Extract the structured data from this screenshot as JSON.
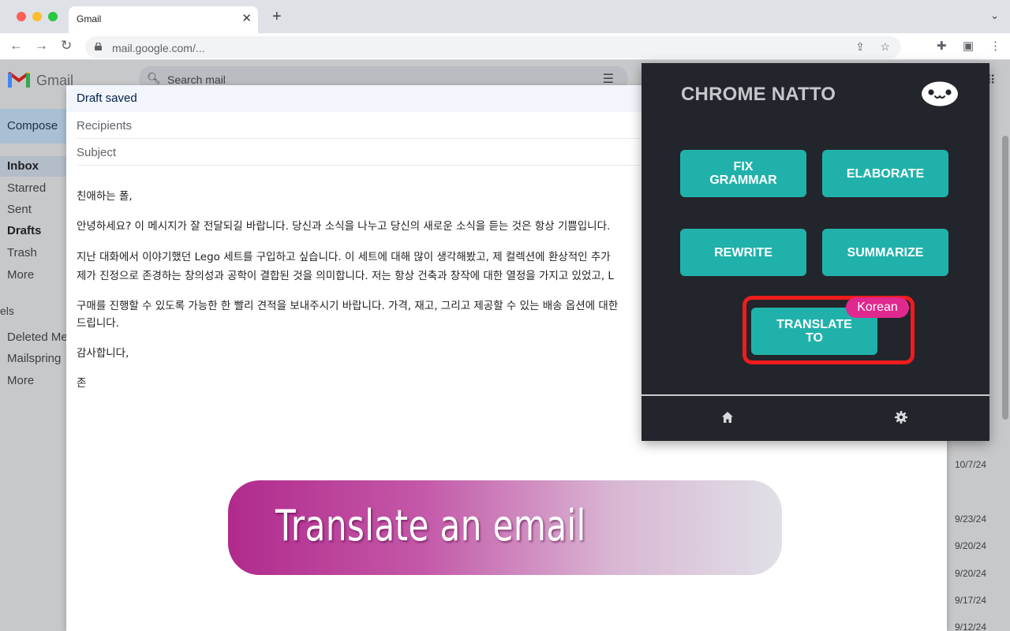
{
  "browser": {
    "tab_title": "Gmail",
    "url": "mail.google.com/..."
  },
  "gmail": {
    "brand": "Gmail",
    "search_placeholder": "Search mail",
    "compose_label": "Compose",
    "nav": [
      "Inbox",
      "Starred",
      "Sent",
      "Drafts",
      "Trash",
      "More"
    ],
    "labels_heading": "els",
    "labels": [
      "Deleted Me",
      "Mailspring",
      "More"
    ],
    "dates": [
      "10/7/24",
      "9/23/24",
      "9/20/24",
      "9/20/24",
      "9/17/24",
      "9/12/24"
    ]
  },
  "compose": {
    "status": "Draft saved",
    "recipients_placeholder": "Recipients",
    "subject_placeholder": "Subject",
    "body_lines": [
      "친애하는 폴,",
      "안녕하세요? 이 메시지가 잘 전달되길 바랍니다. 당신과 소식을 나누고 당신의 새로운 소식을 듣는 것은 항상 기쁨입니다.",
      "지난 대화에서 이야기했던 Lego 세트를 구입하고 싶습니다. 이 세트에 대해 많이 생각해봤고, 제 컬렉션에 환상적인 추가",
      "제가 진정으로 존경하는 창의성과 공학이 결합된 것을 의미합니다. 저는 항상 건축과 창작에 대한 열정을 가지고 있었고, L",
      "구매를 진행할 수 있도록 가능한 한 빨리 견적을 보내주시기 바랍니다. 가격, 재고, 그리고 제공할 수 있는 배송 옵션에 대한",
      "드립니다.",
      "감사합니다,",
      "존"
    ]
  },
  "extension": {
    "title": "CHROME NATTO",
    "buttons": {
      "fix_grammar": "FIX GRAMMAR",
      "elaborate": "ELABORATE",
      "rewrite": "REWRITE",
      "summarize": "SUMMARIZE",
      "translate_to": "TRANSLATE TO"
    },
    "target_language": "Korean",
    "accent_color": "#20b2aa",
    "highlight_color": "#ee1c1c",
    "badge_color": "#e0288f"
  },
  "banner": {
    "text": "Translate an email"
  }
}
